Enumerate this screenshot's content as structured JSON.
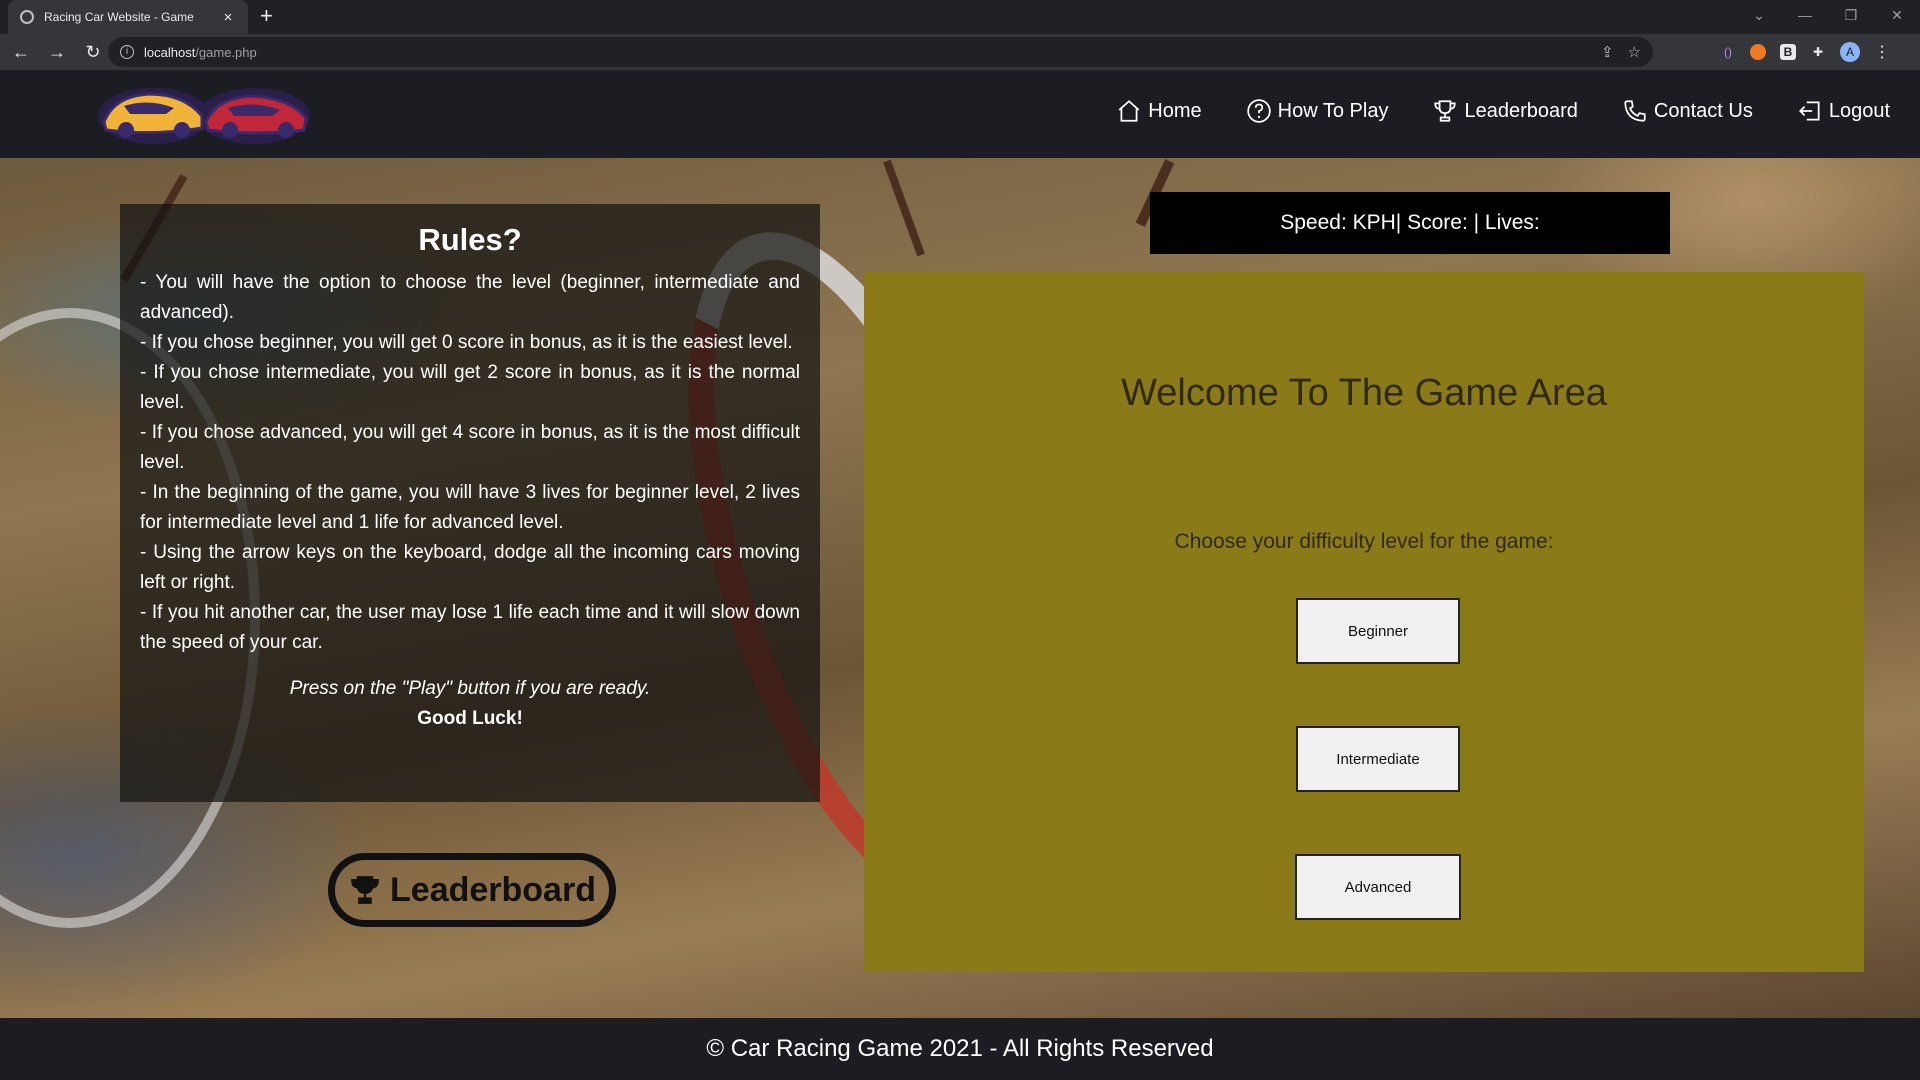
{
  "browser": {
    "tab_title": "Racing Car Website - Game",
    "tab_close": "×",
    "new_tab": "+",
    "url_host": "localhost",
    "url_path": "/game.php",
    "profile_initial": "A"
  },
  "site": {
    "nav": [
      {
        "label": "Home",
        "icon": "home-icon"
      },
      {
        "label": "How To Play",
        "icon": "question-circle-icon"
      },
      {
        "label": "Leaderboard",
        "icon": "trophy-icon"
      },
      {
        "label": "Contact Us",
        "icon": "phone-icon"
      },
      {
        "label": "Logout",
        "icon": "logout-icon"
      }
    ]
  },
  "rules": {
    "title": "Rules?",
    "lines": [
      "- You will have the option to choose the level (beginner, intermediate and advanced).",
      "- If you chose beginner, you will get 0 score in bonus, as it is the easiest level.",
      "- If you chose intermediate, you will get 2 score in bonus, as it is the normal level.",
      "- If you chose advanced, you will get 4 score in bonus, as it is the most difficult level.",
      "- In the beginning of the game, you will have 3 lives for beginner level, 2 lives for intermediate level and 1 life for advanced level.",
      "- Using the arrow keys on the keyboard, dodge all the incoming cars moving left or right.",
      "- If you hit another car, the user may lose 1 life each time and it will slow down the speed of your car."
    ],
    "press": "Press on the \"Play\" button if you are ready.",
    "luck": "Good Luck!"
  },
  "leaderboard_button": {
    "label": "Leaderboard",
    "icon": "trophy-icon"
  },
  "stats_bar": "Speed: KPH| Score: | Lives:",
  "game": {
    "title": "Welcome To The Game Area",
    "subtitle": "Choose your difficulty level for the game:",
    "buttons": [
      "Beginner",
      "Intermediate",
      "Advanced"
    ]
  },
  "footer": "© Car Racing Game 2021 - All Rights Reserved",
  "colors": {
    "header_bg": "#1b1d22",
    "game_area_bg": "#8b7a18",
    "stats_bg": "#000000",
    "logo_car_left": "#f0b43a",
    "logo_car_right": "#c0283a"
  }
}
